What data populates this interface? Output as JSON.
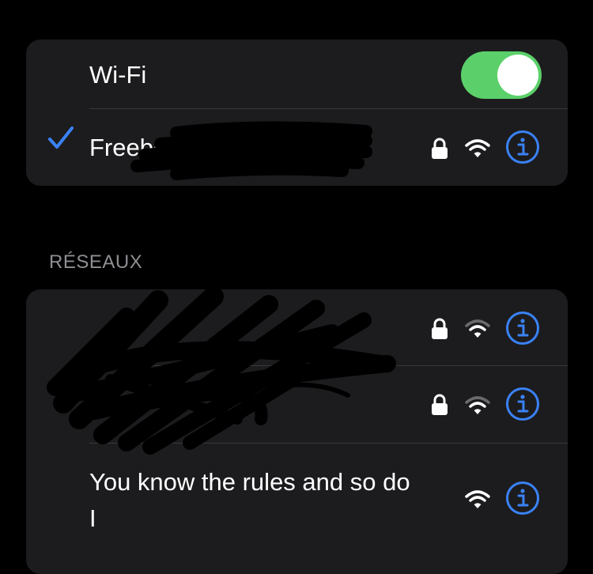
{
  "wifi_card": {
    "wifi_label": "Wi-Fi",
    "wifi_enabled": true,
    "connected_network": {
      "name": "Freebox",
      "checked": true,
      "secured": true,
      "signal": "full"
    }
  },
  "networks_section": {
    "header": "RÉSEAUX",
    "networks": [
      {
        "name": "",
        "secured": true,
        "signal": "medium"
      },
      {
        "name": "",
        "secured": true,
        "signal": "medium"
      },
      {
        "name": "You know the rules and so do I",
        "secured": false,
        "signal": "full"
      }
    ]
  },
  "colors": {
    "background": "#000000",
    "card": "#1c1c1e",
    "separator": "#38383a",
    "toggle_on": "#5bd06a",
    "accent_blue": "#3a82f7",
    "section_header": "#8e8e93"
  },
  "icons": {
    "checkmark": "checkmark-icon",
    "lock": "lock-icon",
    "wifi": "wifi-signal-icon",
    "info": "info-icon"
  }
}
